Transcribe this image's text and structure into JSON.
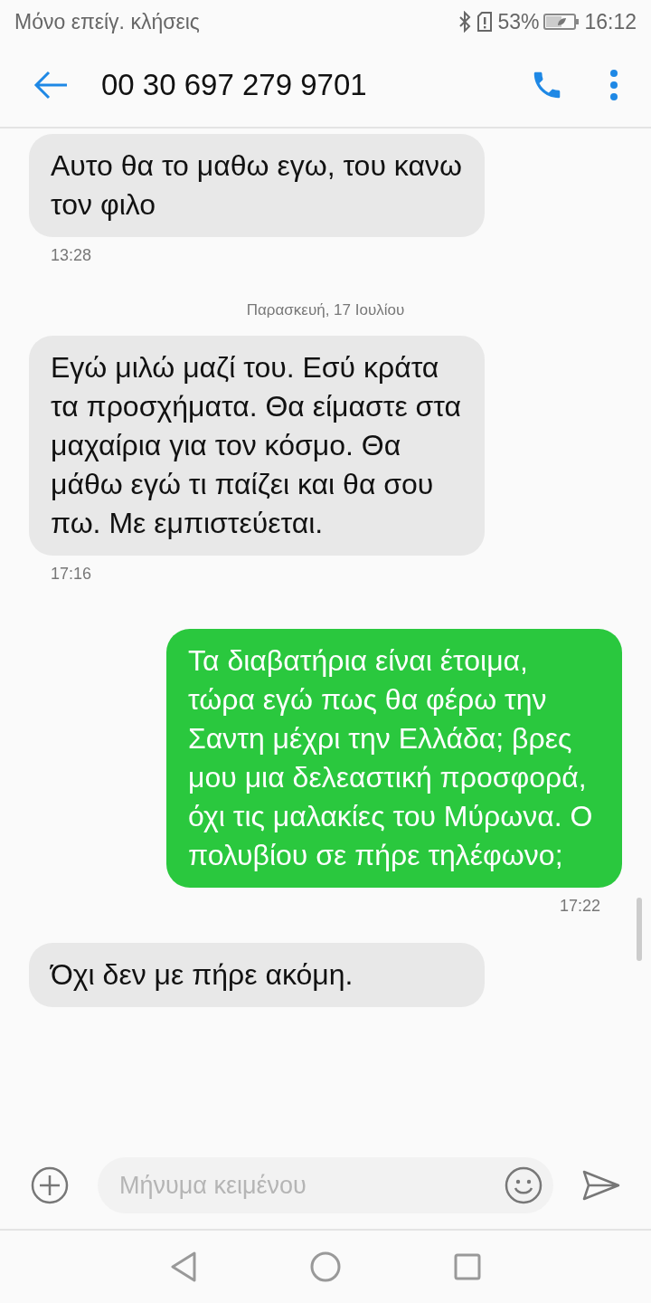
{
  "status_bar": {
    "carrier": "Μόνο επείγ. κλήσεις",
    "battery": "53%",
    "time": "16:12"
  },
  "header": {
    "title": "00 30 697 279 9701"
  },
  "messages": [
    {
      "kind": "incoming",
      "text": "Αυτο θα το μαθω εγω, του κανω τον φιλο",
      "time": "13:28"
    },
    {
      "kind": "date",
      "text": "Παρασκευή, 17 Ιουλίου"
    },
    {
      "kind": "incoming",
      "text": "Εγώ μιλώ μαζί του. Εσύ κράτα τα προσχήματα. Θα είμαστε στα μαχαίρια για τον κόσμο. Θα μάθω εγώ τι παίζει και θα σου πω. Με εμπιστεύεται.",
      "time": "17:16"
    },
    {
      "kind": "outgoing",
      "text": "Τα διαβατήρια είναι έτοιμα, τώρα εγώ πως θα φέρω την Σαντη μέχρι την Ελλάδα; βρες μου μια δελεαστική προσφορά, όχι τις μαλακίες του Μύρωνα. Ο πολυβίου σε πήρε τηλέφωνο;",
      "time": "17:22"
    },
    {
      "kind": "incoming",
      "text": "Όχι δεν με πήρε ακόμη."
    }
  ],
  "composer": {
    "placeholder": "Μήνυμα κειμένου"
  }
}
